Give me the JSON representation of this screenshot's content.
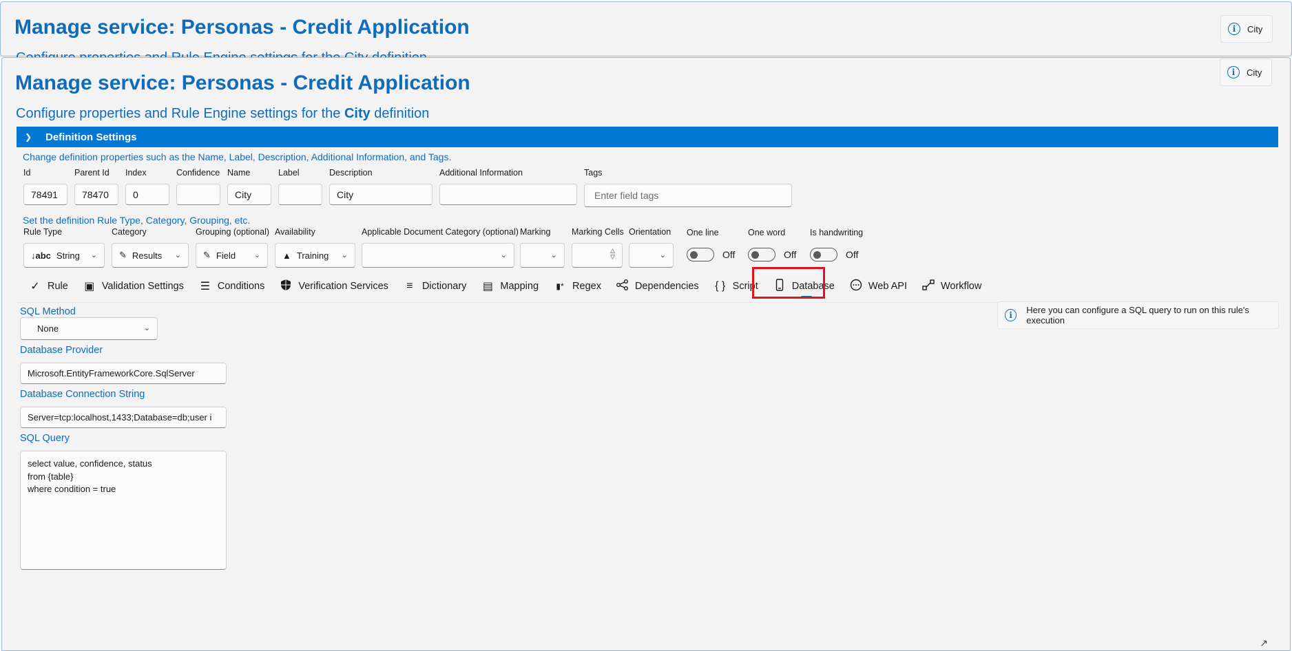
{
  "back_window": {
    "title": "Manage service: Personas - Credit Application",
    "subtitle": "Configure properties and Rule Engine settings for the City definition",
    "chip_label": "City"
  },
  "header": {
    "title": "Manage service: Personas - Credit Application",
    "subtitle_prefix": "Configure properties and Rule Engine settings for the ",
    "subtitle_bold": "City",
    "subtitle_suffix": " definition",
    "chip_label": "City"
  },
  "section": {
    "title": "Definition Settings",
    "hint_properties": "Change definition properties such as the Name, Label, Description, Additional Information, and Tags.",
    "hint_rule": "Set the definition Rule Type, Category, Grouping, etc."
  },
  "fields": {
    "id": {
      "label": "Id",
      "value": "78491"
    },
    "parent_id": {
      "label": "Parent Id",
      "value": "78470"
    },
    "index": {
      "label": "Index",
      "value": "0"
    },
    "confidence": {
      "label": "Confidence",
      "value": ""
    },
    "name": {
      "label": "Name",
      "value": "City"
    },
    "label": {
      "label": "Label",
      "value": ""
    },
    "description": {
      "label": "Description",
      "value": "City"
    },
    "additional_info": {
      "label": "Additional Information",
      "value": ""
    },
    "tags": {
      "label": "Tags",
      "placeholder": "Enter field tags"
    }
  },
  "selects": {
    "rule_type": {
      "label": "Rule Type",
      "value": "String",
      "icon": "↓abc"
    },
    "category": {
      "label": "Category",
      "value": "Results"
    },
    "grouping": {
      "label": "Grouping (optional)",
      "value": "Field"
    },
    "availability": {
      "label": "Availability",
      "value": "Training"
    },
    "doc_category": {
      "label": "Applicable Document Category (optional)",
      "value": ""
    },
    "marking": {
      "label": "Marking",
      "value": ""
    },
    "marking_cells": {
      "label": "Marking Cells",
      "value": ""
    },
    "orientation": {
      "label": "Orientation",
      "value": ""
    }
  },
  "toggles": {
    "one_line": {
      "label": "One line",
      "state": "Off"
    },
    "one_word": {
      "label": "One word",
      "state": "Off"
    },
    "is_handwriting": {
      "label": "Is handwriting",
      "state": "Off"
    }
  },
  "tabs": [
    {
      "label": "Rule",
      "icon": "check-icon"
    },
    {
      "label": "Validation Settings",
      "icon": "validation-icon"
    },
    {
      "label": "Conditions",
      "icon": "list-check-icon"
    },
    {
      "label": "Verification Services",
      "icon": "shield-icon"
    },
    {
      "label": "Dictionary",
      "icon": "dictionary-icon"
    },
    {
      "label": "Mapping",
      "icon": "book-icon"
    },
    {
      "label": "Regex",
      "icon": "regex-icon"
    },
    {
      "label": "Dependencies",
      "icon": "share-icon"
    },
    {
      "label": "Script",
      "icon": "braces-icon"
    },
    {
      "label": "Database",
      "icon": "phone-icon"
    },
    {
      "label": "Web API",
      "icon": "more-circle-icon"
    },
    {
      "label": "Workflow",
      "icon": "workflow-icon"
    }
  ],
  "active_tab": "Database",
  "database": {
    "sql_method_label": "SQL Method",
    "sql_method_value": "None",
    "provider_label": "Database Provider",
    "provider_value": "Microsoft.EntityFrameworkCore.SqlServer",
    "connection_label": "Database Connection String",
    "connection_value": "Server=tcp:localhost,1433;Database=db;user i",
    "query_label": "SQL Query",
    "query_lines": [
      "select value, confidence, status",
      "from {table}",
      "where condition = true"
    ],
    "info_text": "Here you can configure a SQL query to run on this rule's execution"
  },
  "colors": {
    "accent": "#0078d4",
    "text_blue": "#0f6cbd",
    "highlight": "#e0141e"
  }
}
